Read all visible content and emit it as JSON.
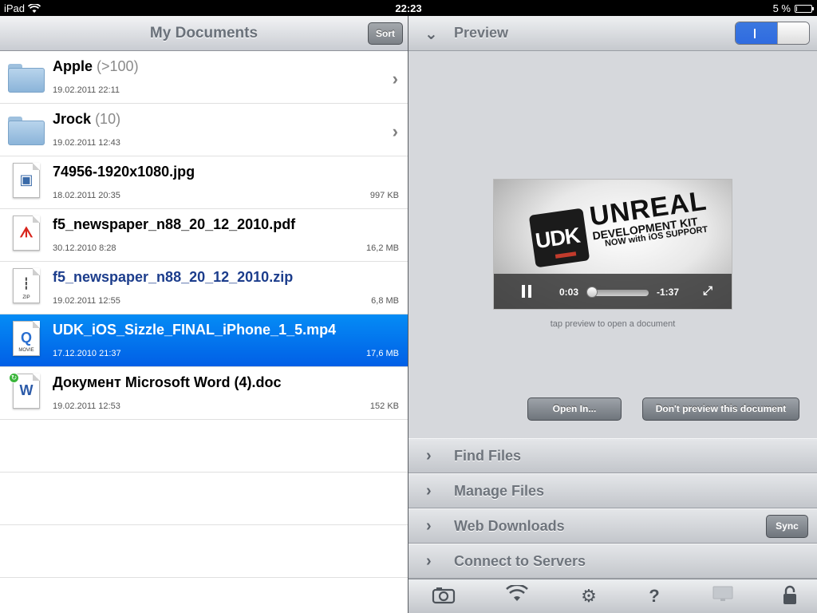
{
  "status": {
    "device": "iPad",
    "time": "22:23",
    "battery_percent": "5 %",
    "battery_level": 0.05
  },
  "documents": {
    "title": "My Documents",
    "sort_label": "Sort",
    "items": [
      {
        "name": "Apple",
        "count": "(>100)",
        "date": "19.02.2011 22:11",
        "size": "",
        "type": "folder-icon"
      },
      {
        "name": "Jrock",
        "count": "(10)",
        "date": "19.02.2011 12:43",
        "size": "",
        "type": "folder-icon"
      },
      {
        "name": "74956-1920x1080.jpg",
        "count": "",
        "date": "18.02.2011 20:35",
        "size": "997 KB",
        "type": "image-file-icon"
      },
      {
        "name": "f5_newspaper_n88_20_12_2010.pdf",
        "count": "",
        "date": "30.12.2010 8:28",
        "size": "16,2 MB",
        "type": "pdf-file-icon"
      },
      {
        "name": "f5_newspaper_n88_20_12_2010.zip",
        "count": "",
        "date": "19.02.2011 12:55",
        "size": "6,8 MB",
        "type": "zip-file-icon"
      },
      {
        "name": "UDK_iOS_Sizzle_FINAL_iPhone_1_5.mp4",
        "count": "",
        "date": "17.12.2010 21:37",
        "size": "17,6 MB",
        "type": "movie-file-icon"
      },
      {
        "name": "Документ Microsoft Word (4).doc",
        "count": "",
        "date": "19.02.2011 12:53",
        "size": "152 KB",
        "type": "word-file-icon"
      }
    ]
  },
  "preview": {
    "title": "Preview",
    "toggle_on": true,
    "video": {
      "logo_text": "UDK",
      "line1": "UNREAL",
      "line2": "DEVELOPMENT KIT",
      "line3": "NOW with iOS SUPPORT",
      "current_time": "0:03",
      "remaining_time": "-1:37"
    },
    "hint": "tap preview to open a document",
    "open_in_label": "Open In...",
    "dont_preview_label": "Don't preview this document"
  },
  "sections": [
    {
      "label": "Find Files"
    },
    {
      "label": "Manage Files"
    },
    {
      "label": "Web Downloads",
      "button": "Sync"
    },
    {
      "label": "Connect to Servers"
    }
  ],
  "toolbar": {
    "icons": [
      "camera-icon",
      "wifi-icon",
      "gear-icon",
      "help-icon",
      "display-icon",
      "lock-icon"
    ]
  },
  "colors": {
    "selection": "#015fe6",
    "accent": "#2f6be0",
    "link_blue": "#1c3d8c"
  }
}
